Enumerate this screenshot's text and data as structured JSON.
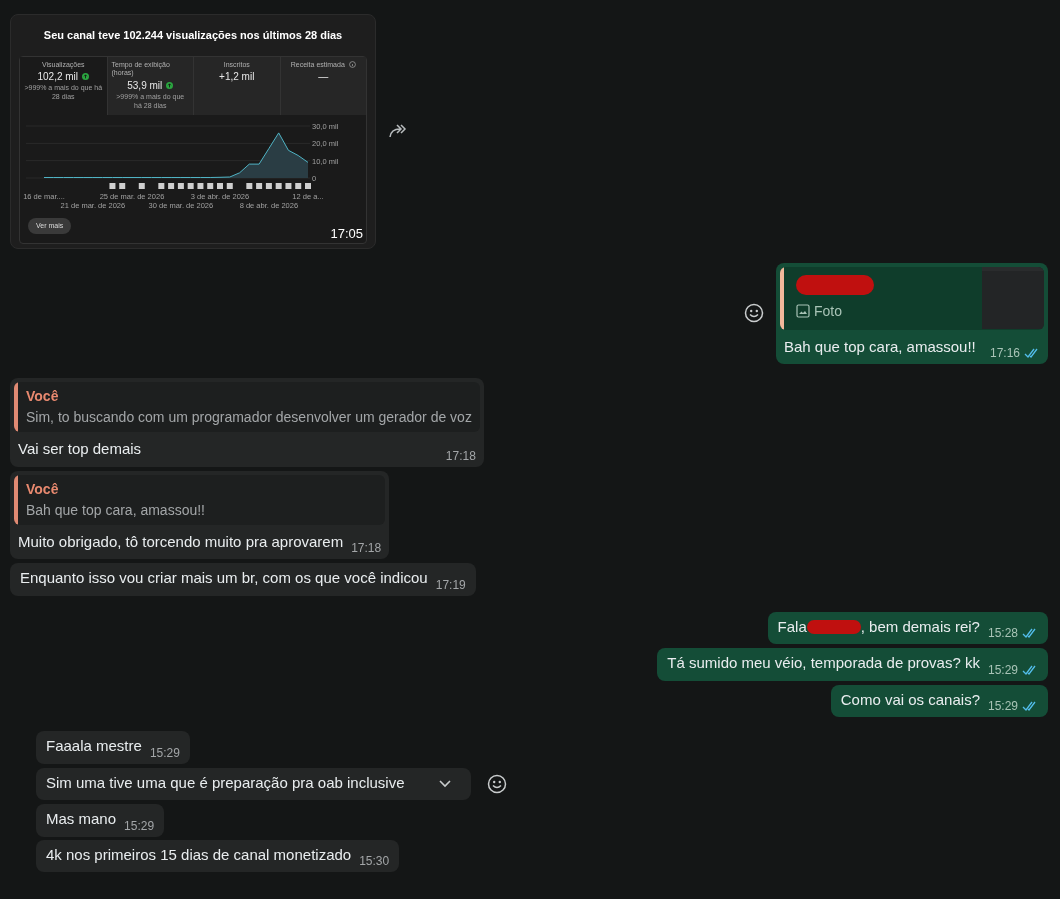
{
  "messages": [
    {
      "kind": "image",
      "outgoing": false,
      "time": "17:05",
      "card": {
        "title": "Seu canal teve 102.244 visualizações nos últimos 28 dias",
        "stats": [
          {
            "label": "Visualizações",
            "value": "102,2 mil",
            "trend_up": true,
            "note": ">999% a mais do que há 28 dias",
            "info": false,
            "selected": true
          },
          {
            "label": "Tempo de exibição (horas)",
            "value": "53,9 mil",
            "trend_up": true,
            "note": ">999% a mais do que há 28 dias",
            "info": false,
            "selected": false
          },
          {
            "label": "Inscritos",
            "value": "+1,2 mil",
            "trend_up": false,
            "info": false,
            "selected": false
          },
          {
            "label": "Receita estimada",
            "value": "—",
            "trend_up": false,
            "info": true,
            "selected": false
          }
        ],
        "chart_data": {
          "type": "area",
          "categories": [
            "16 de mar....",
            null,
            null,
            null,
            null,
            "21 de mar. de 2026",
            null,
            null,
            null,
            "25 de mar. de 2026",
            null,
            null,
            null,
            null,
            "30 de mar. de 2026",
            null,
            null,
            null,
            "3 de abr. de 2026",
            null,
            null,
            null,
            null,
            "8 de abr. de 2026",
            null,
            null,
            null,
            "12 de a..."
          ],
          "series": [
            {
              "color": "#4fb3c4",
              "values": [
                0.3,
                0.3,
                0.3,
                0.3,
                0.3,
                0.3,
                0.3,
                0.3,
                0.3,
                0.3,
                0.3,
                0.3,
                0.3,
                0.3,
                0.3,
                0.3,
                0.3,
                0.3,
                0.4,
                0.6,
                3,
                8,
                8,
                17,
                26,
                16,
                13,
                9
              ]
            }
          ],
          "ylim": [
            0,
            30
          ],
          "yticks": [
            {
              "value": 0,
              "label": "0"
            },
            {
              "value": 10,
              "label": "10,0 mil"
            },
            {
              "value": 20,
              "label": "20,0 mil"
            },
            {
              "value": 30,
              "label": "30,0 mil"
            }
          ]
        },
        "button": "Ver mais"
      }
    },
    {
      "kind": "reply",
      "outgoing": true,
      "quote": {
        "author_redacted": true,
        "label": "Foto"
      },
      "text": "Bah que top cara, amassou!!",
      "time": "17:16",
      "read": true
    },
    {
      "kind": "reply",
      "outgoing": false,
      "quote": {
        "author": "Você",
        "text": "Sim, to buscando com um programador desenvolver um gerador de voz"
      },
      "text": "Vai ser top demais",
      "time": "17:18"
    },
    {
      "kind": "reply",
      "outgoing": false,
      "quote": {
        "author": "Você",
        "text": "Bah que top cara, amassou!!"
      },
      "text": "Muito obrigado, tô torcendo muito pra aprovarem",
      "time": "17:18"
    },
    {
      "kind": "text",
      "outgoing": false,
      "text": "Enquanto isso vou criar mais um br, com os que você indicou",
      "time": "17:19"
    },
    {
      "kind": "text",
      "outgoing": true,
      "text": "Fala",
      "redacted_name": true,
      "text_2": ", bem demais rei?",
      "time": "15:28",
      "read": true
    },
    {
      "kind": "text",
      "outgoing": true,
      "text": "Tá sumido meu véio, temporada de provas? kk",
      "time": "15:29",
      "read": true
    },
    {
      "kind": "text",
      "outgoing": true,
      "text": "Como vai os canais?",
      "time": "15:29",
      "read": true
    },
    {
      "kind": "text",
      "outgoing": false,
      "text": "Faaala mestre",
      "time": "15:29"
    },
    {
      "kind": "text",
      "outgoing": false,
      "text": "Sim uma tive uma que é preparação pra oab inclusive",
      "hovered": true
    },
    {
      "kind": "text",
      "outgoing": false,
      "text": "Mas mano",
      "time": "15:29"
    },
    {
      "kind": "text",
      "outgoing": false,
      "text": "4k nos primeiros 15 dias de canal monetizado",
      "time": "15:30"
    }
  ]
}
